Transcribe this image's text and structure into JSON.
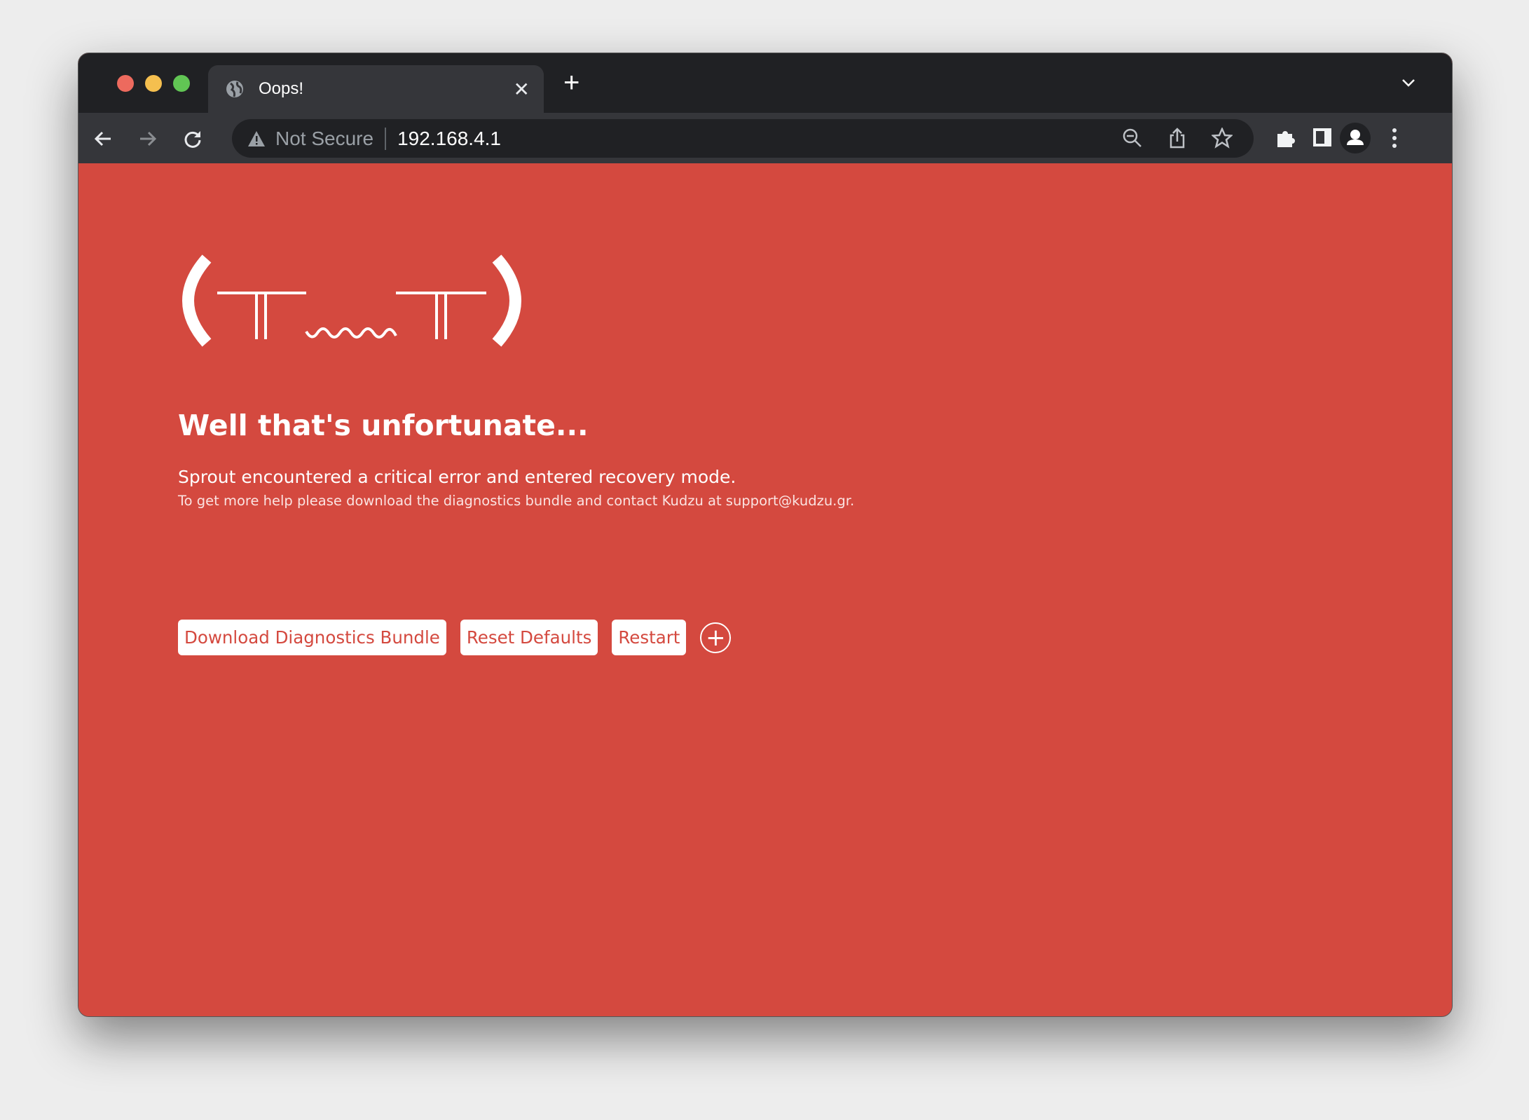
{
  "browser": {
    "tab_title": "Oops!",
    "security_label": "Not Secure",
    "url": "192.168.4.1",
    "icons": [
      "back-icon",
      "forward-icon",
      "reload-icon",
      "warning-icon",
      "zoom-out-icon",
      "share-icon",
      "star-icon",
      "extensions-icon",
      "side-panel-icon",
      "profile-icon",
      "menu-icon",
      "tab-search-chevron-icon"
    ]
  },
  "page": {
    "kaomoji": "(╥﹏╥)",
    "heading": "Well that's unfortunate...",
    "message": "Sprout encountered a critical error and entered recovery mode.",
    "help": "To get more help please download the diagnostics bundle and contact Kudzu at support@kudzu.gr.",
    "buttons": {
      "download": "Download Diagnostics Bundle",
      "reset": "Reset Defaults",
      "restart": "Restart",
      "more": "+"
    }
  },
  "colors": {
    "background": "#d4493f",
    "button_text": "#d4493f",
    "chrome_dark": "#202124",
    "chrome_toolbar": "#35363a"
  }
}
